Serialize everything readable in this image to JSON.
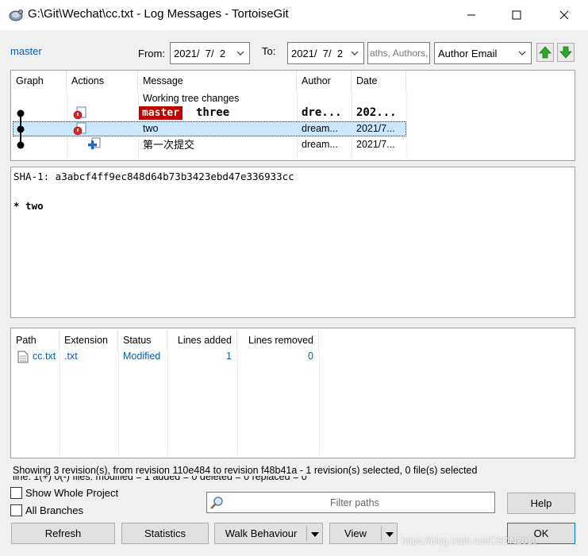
{
  "window": {
    "title": "G:\\Git\\Wechat\\cc.txt - Log Messages - TortoiseGit",
    "minimize": "minimize",
    "maximize": "maximize",
    "close": "close"
  },
  "toolbar": {
    "branch": "master",
    "from_label": "From:",
    "from_date": "2021/  7/  2",
    "to_label": "To:",
    "to_date": "2021/  7/  2",
    "search_placeholder": "aths, Authors,",
    "filter_field": "Author Email"
  },
  "log": {
    "columns": [
      "Graph",
      "Actions",
      "Message",
      "Author",
      "Date"
    ],
    "working_tree": "Working tree changes",
    "rows": [
      {
        "ref": "master",
        "message": "three",
        "author": "dre...",
        "date": "202..."
      },
      {
        "message": "two",
        "author": "dream...",
        "date": "2021/7..."
      },
      {
        "message": "第一次提交",
        "author": "dream...",
        "date": "2021/7..."
      }
    ]
  },
  "detail": {
    "sha": "SHA-1: a3abcf4ff9ec848d64b73b3423ebd47e336933cc",
    "message": "* two"
  },
  "files": {
    "columns": [
      "Path",
      "Extension",
      "Status",
      "Lines added",
      "Lines removed"
    ],
    "rows": [
      {
        "path": "cc.txt",
        "extension": ".txt",
        "status": "Modified",
        "added": "1",
        "removed": "0"
      }
    ]
  },
  "status": {
    "line1": "Showing 3 revision(s), from revision 110e484 to revision f48b41a - 1 revision(s) selected, 0 file(s) selected",
    "line2": "line: 1(+) 0(-) files: modified = 1 added = 0 deleted = 0 replaced = 0"
  },
  "bottom": {
    "show_whole_project": "Show Whole Project",
    "all_branches": "All Branches",
    "filter_placeholder": "Filter paths",
    "help": "Help",
    "refresh": "Refresh",
    "statistics": "Statistics",
    "walk_behaviour": "Walk Behaviour",
    "view": "View",
    "ok": "OK",
    "watermark": "https://blog.csdn.net/CSDN2019"
  },
  "colors": {
    "accent": "#0b5cad",
    "selection": "#cce8ff",
    "ref_badge": "#c00000",
    "arrow_green": "#2fa82f"
  }
}
